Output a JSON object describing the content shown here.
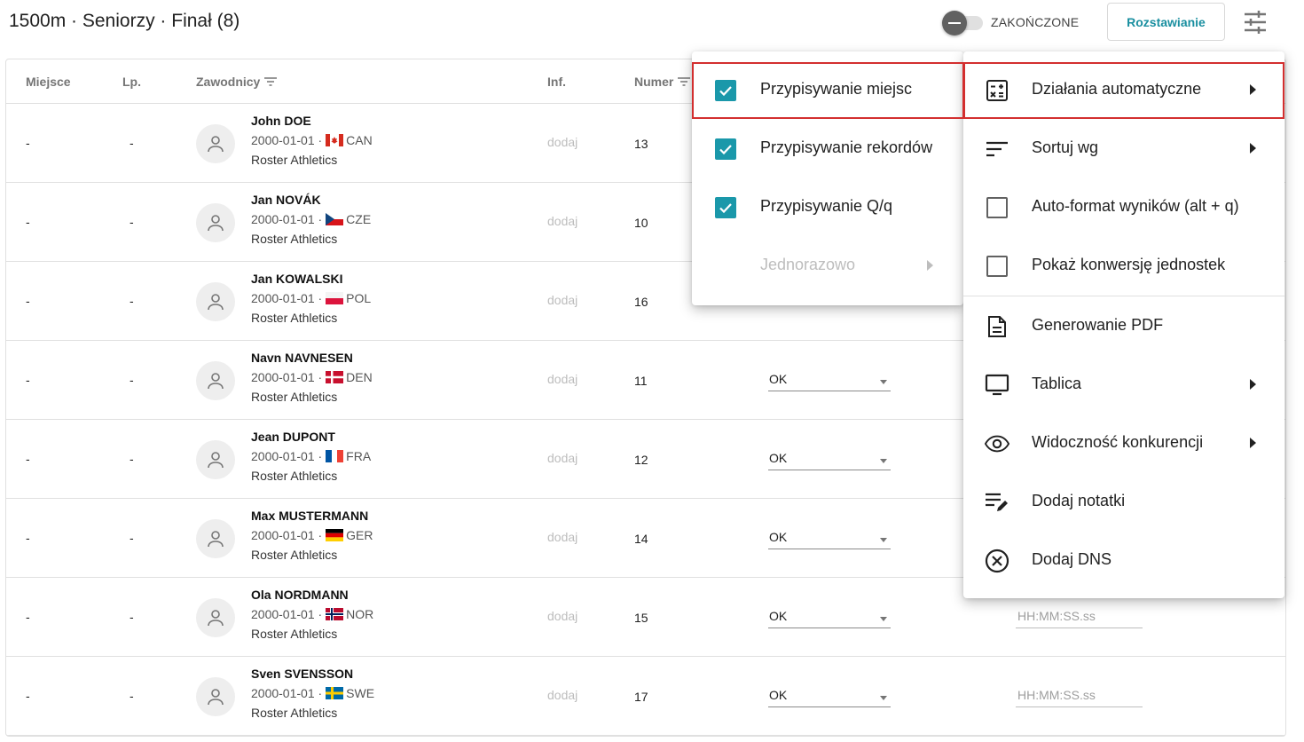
{
  "header": {
    "title": "1500m · Seniorzy · Finał (8)",
    "toggle_label": "ZAKOŃCZONE",
    "seed_button": "Rozstawianie"
  },
  "table": {
    "columns": {
      "place": "Miejsce",
      "lp": "Lp.",
      "athletes": "Zawodnicy",
      "inf": "Inf.",
      "number": "Numer"
    },
    "rows": [
      {
        "place": "-",
        "lp": "-",
        "name": "John DOE",
        "dob": "2000-01-01 ·",
        "country": "CAN",
        "club": "Roster Athletics",
        "inf": "dodaj",
        "number": "13",
        "status": "",
        "time": ""
      },
      {
        "place": "-",
        "lp": "-",
        "name": "Jan NOVÁK",
        "dob": "2000-01-01 ·",
        "country": "CZE",
        "club": "Roster Athletics",
        "inf": "dodaj",
        "number": "10",
        "status": "",
        "time": ""
      },
      {
        "place": "-",
        "lp": "-",
        "name": "Jan KOWALSKI",
        "dob": "2000-01-01 ·",
        "country": "POL",
        "club": "Roster Athletics",
        "inf": "dodaj",
        "number": "16",
        "status": "",
        "time": ""
      },
      {
        "place": "-",
        "lp": "-",
        "name": "Navn NAVNESEN",
        "dob": "2000-01-01 ·",
        "country": "DEN",
        "club": "Roster Athletics",
        "inf": "dodaj",
        "number": "11",
        "status": "OK",
        "time": ""
      },
      {
        "place": "-",
        "lp": "-",
        "name": "Jean DUPONT",
        "dob": "2000-01-01 ·",
        "country": "FRA",
        "club": "Roster Athletics",
        "inf": "dodaj",
        "number": "12",
        "status": "OK",
        "time": ""
      },
      {
        "place": "-",
        "lp": "-",
        "name": "Max MUSTERMANN",
        "dob": "2000-01-01 ·",
        "country": "GER",
        "club": "Roster Athletics",
        "inf": "dodaj",
        "number": "14",
        "status": "OK",
        "time": ""
      },
      {
        "place": "-",
        "lp": "-",
        "name": "Ola NORDMANN",
        "dob": "2000-01-01 ·",
        "country": "NOR",
        "club": "Roster Athletics",
        "inf": "dodaj",
        "number": "15",
        "status": "OK",
        "time": "HH:MM:SS.ss"
      },
      {
        "place": "-",
        "lp": "-",
        "name": "Sven SVENSSON",
        "dob": "2000-01-01 ·",
        "country": "SWE",
        "club": "Roster Athletics",
        "inf": "dodaj",
        "number": "17",
        "status": "OK",
        "time": "HH:MM:SS.ss"
      }
    ]
  },
  "main_menu": {
    "items": [
      {
        "label": "Działania automatyczne",
        "icon": "calculator-icon",
        "arrow": true,
        "highlighted": true
      },
      {
        "label": "Sortuj wg",
        "icon": "sort-icon",
        "arrow": true
      },
      {
        "label": "Auto-format wyników (alt + q)",
        "icon": "checkbox-empty-icon",
        "arrow": false
      },
      {
        "label": "Pokaż konwersję jednostek",
        "icon": "checkbox-empty-icon",
        "arrow": false
      },
      {
        "label": "Generowanie PDF",
        "icon": "document-icon",
        "arrow": false
      },
      {
        "label": "Tablica",
        "icon": "monitor-icon",
        "arrow": true
      },
      {
        "label": "Widoczność konkurencji",
        "icon": "eye-icon",
        "arrow": true
      },
      {
        "label": "Dodaj notatki",
        "icon": "edit-notes-icon",
        "arrow": false
      },
      {
        "label": "Dodaj DNS",
        "icon": "cancel-circle-icon",
        "arrow": false
      }
    ]
  },
  "sub_menu": {
    "items": [
      {
        "label": "Przypisywanie miejsc",
        "checked": true,
        "highlighted": true
      },
      {
        "label": "Przypisywanie rekordów",
        "checked": true
      },
      {
        "label": "Przypisywanie Q/q",
        "checked": true
      },
      {
        "label": "Jednorazowo",
        "disabled": true,
        "arrow": true
      }
    ]
  },
  "colors": {
    "accent": "#1a98aa",
    "highlight": "#d32f2f",
    "seed_text": "#1a8fa0"
  }
}
